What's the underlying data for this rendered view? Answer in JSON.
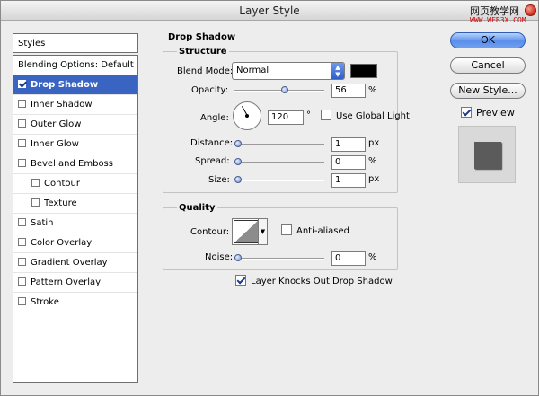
{
  "window": {
    "title": "Layer Style"
  },
  "watermark": {
    "line1": "网页教学网",
    "line2": "WWW.WEB3X.COM"
  },
  "sidebar": {
    "header": "Styles",
    "items": [
      {
        "label": "Blending Options: Default",
        "checkbox": false,
        "checked": false,
        "selected": false,
        "indent": false
      },
      {
        "label": "Drop Shadow",
        "checkbox": true,
        "checked": true,
        "selected": true,
        "indent": false
      },
      {
        "label": "Inner Shadow",
        "checkbox": true,
        "checked": false,
        "selected": false,
        "indent": false
      },
      {
        "label": "Outer Glow",
        "checkbox": true,
        "checked": false,
        "selected": false,
        "indent": false
      },
      {
        "label": "Inner Glow",
        "checkbox": true,
        "checked": false,
        "selected": false,
        "indent": false
      },
      {
        "label": "Bevel and Emboss",
        "checkbox": true,
        "checked": false,
        "selected": false,
        "indent": false
      },
      {
        "label": "Contour",
        "checkbox": true,
        "checked": false,
        "selected": false,
        "indent": true
      },
      {
        "label": "Texture",
        "checkbox": true,
        "checked": false,
        "selected": false,
        "indent": true
      },
      {
        "label": "Satin",
        "checkbox": true,
        "checked": false,
        "selected": false,
        "indent": false
      },
      {
        "label": "Color Overlay",
        "checkbox": true,
        "checked": false,
        "selected": false,
        "indent": false
      },
      {
        "label": "Gradient Overlay",
        "checkbox": true,
        "checked": false,
        "selected": false,
        "indent": false
      },
      {
        "label": "Pattern Overlay",
        "checkbox": true,
        "checked": false,
        "selected": false,
        "indent": false
      },
      {
        "label": "Stroke",
        "checkbox": true,
        "checked": false,
        "selected": false,
        "indent": false
      }
    ]
  },
  "drop_shadow": {
    "title": "Drop Shadow",
    "structure": {
      "title": "Structure",
      "blend_mode_label": "Blend Mode:",
      "blend_mode_value": "Normal",
      "shadow_color": "#000000",
      "opacity_label": "Opacity:",
      "opacity_value": "56",
      "opacity_unit": "%",
      "opacity_slider": 0.56,
      "angle_label": "Angle:",
      "angle_value": "120",
      "angle_unit": "°",
      "global_light_label": "Use Global Light",
      "global_light_checked": false,
      "distance_label": "Distance:",
      "distance_value": "1",
      "distance_unit": "px",
      "distance_slider": 0.0,
      "spread_label": "Spread:",
      "spread_value": "0",
      "spread_unit": "%",
      "spread_slider": 0.0,
      "size_label": "Size:",
      "size_value": "1",
      "size_unit": "px",
      "size_slider": 0.0
    },
    "quality": {
      "title": "Quality",
      "contour_label": "Contour:",
      "anti_aliased_label": "Anti-aliased",
      "anti_aliased_checked": false,
      "noise_label": "Noise:",
      "noise_value": "0",
      "noise_unit": "%",
      "noise_slider": 0.0
    },
    "knockout_label": "Layer Knocks Out Drop Shadow",
    "knockout_checked": true
  },
  "buttons": {
    "ok": "OK",
    "cancel": "Cancel",
    "new_style": "New Style...",
    "preview_label": "Preview",
    "preview_checked": true
  },
  "colors": {
    "selection": "#3a64c2",
    "accent": "#5a8eea"
  }
}
